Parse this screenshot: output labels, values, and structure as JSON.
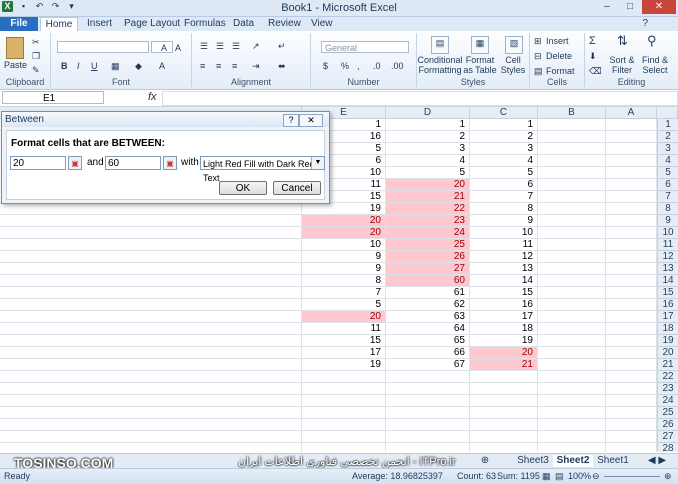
{
  "window": {
    "title": "Book1 - Microsoft Excel"
  },
  "ribbon": {
    "tabs": [
      "File",
      "Home",
      "Insert",
      "Page Layout",
      "Formulas",
      "Data",
      "Review",
      "View"
    ],
    "groups": [
      "Clipboard",
      "Font",
      "Alignment",
      "Number",
      "Styles",
      "Cells",
      "Editing"
    ],
    "paste_label": "Paste",
    "number_format_value": "General",
    "conditional_formatting": "Conditional Formatting",
    "format_as_table": "Format as Table",
    "cell_styles": "Cell Styles",
    "insert": "Insert",
    "delete": "Delete",
    "format": "Format",
    "sort_filter": "Sort & Filter",
    "find_select": "Find & Select"
  },
  "formula_bar": {
    "name_box": "E1",
    "fx": "fx"
  },
  "columns": [
    "E",
    "D",
    "C",
    "B",
    "A"
  ],
  "rows": [
    "1",
    "2",
    "3",
    "4",
    "5",
    "6",
    "7",
    "8",
    "9",
    "10",
    "11",
    "12",
    "13",
    "14",
    "15",
    "16",
    "17",
    "18",
    "19",
    "20",
    "21",
    "22",
    "23",
    "24",
    "25",
    "26",
    "27",
    "28"
  ],
  "cells": {
    "E": [
      "1",
      "16",
      "5",
      "6",
      "10",
      "11",
      "15",
      "19",
      "20",
      "20",
      "10",
      "9",
      "9",
      "8",
      "7",
      "5",
      "20",
      "11",
      "15",
      "17",
      "19"
    ],
    "D": [
      "1",
      "2",
      "3",
      "4",
      "5",
      "20",
      "21",
      "22",
      "23",
      "24",
      "25",
      "26",
      "27",
      "60",
      "61",
      "62",
      "63",
      "64",
      "65",
      "66",
      "67"
    ],
    "C": [
      "1",
      "2",
      "3",
      "4",
      "5",
      "6",
      "7",
      "8",
      "9",
      "10",
      "11",
      "12",
      "13",
      "14",
      "15",
      "16",
      "17",
      "18",
      "19",
      "20",
      "21"
    ]
  },
  "highlight_color": "#ffc7ce",
  "highlight_text_color": "#9c0006",
  "dialog": {
    "title": "Between",
    "heading": "Format cells that are BETWEEN:",
    "low_value": "20",
    "and_label": "and",
    "high_value": "60",
    "with_label": "with",
    "format_option": "Light Red Fill with Dark Red Text",
    "ok_label": "OK",
    "cancel_label": "Cancel",
    "help_glyph": "?",
    "close_glyph": "✕"
  },
  "sheets": {
    "tabs": [
      "Sheet3",
      "Sheet2",
      "Sheet1"
    ],
    "active": "Sheet2"
  },
  "status": {
    "ready": "Ready",
    "average": "Average: 18.96825397",
    "count": "Count: 63",
    "sum": "Sum: 1195",
    "zoom": "100%"
  },
  "watermark": {
    "left": "TOSINSO.COM",
    "right": "انجمن تخصصی فناوری اطلاعات ایران - ITPro.ir"
  }
}
